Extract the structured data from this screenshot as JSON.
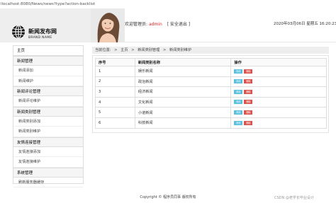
{
  "url_bar": {
    "text": "llocalhost:8080/News/news?type?action-backlist"
  },
  "header": {
    "brand_title": "新闻发布网",
    "brand_sub": "BRAND NAME",
    "welcome_prefix": "欢迎管理员:",
    "username": "admin",
    "logout_label": "[ 安全退出 ]",
    "datetime": "2020年03月06日 星期五 16:20:23"
  },
  "sidebar": {
    "home": "主页",
    "groups": [
      {
        "title": "新闻管理",
        "items": [
          "新闻添加",
          "新闻维护"
        ]
      },
      {
        "title": "新闻评论管理",
        "items": [
          "新闻评论维护"
        ]
      },
      {
        "title": "新闻类别管理",
        "items": [
          "新闻类别添加",
          "新闻类别维护"
        ]
      },
      {
        "title": "友情连接管理",
        "items": [
          "友情连接添加",
          "友情连接维护"
        ]
      },
      {
        "title": "系统管理",
        "items": [
          "刷新服务器缓存"
        ]
      }
    ]
  },
  "breadcrumb": {
    "prefix": "当前位置:",
    "items": [
      "主页",
      "新闻类别管理",
      "新闻类别维护"
    ],
    "separator": ">"
  },
  "table": {
    "headers": [
      "序号",
      "新闻类别名称",
      "操作"
    ],
    "rows": [
      {
        "id": "1",
        "name": "娱乐新闻"
      },
      {
        "id": "2",
        "name": "政治新闻"
      },
      {
        "id": "3",
        "name": "经济新闻"
      },
      {
        "id": "4",
        "name": "文化新闻"
      },
      {
        "id": "5",
        "name": "小道新闻"
      },
      {
        "id": "6",
        "name": "科技新闻"
      }
    ],
    "edit_label": "修改",
    "delete_label": "删除"
  },
  "footer": {
    "copyright": "Copyright © 程序员同事 版权所有"
  },
  "watermark": {
    "text": "CSDN @老学长毕业设计"
  },
  "colors": {
    "username": "#e02020",
    "edit_button": "#5bc0de",
    "delete_button": "#d9534f",
    "brand_panel": "#eeeeee"
  }
}
